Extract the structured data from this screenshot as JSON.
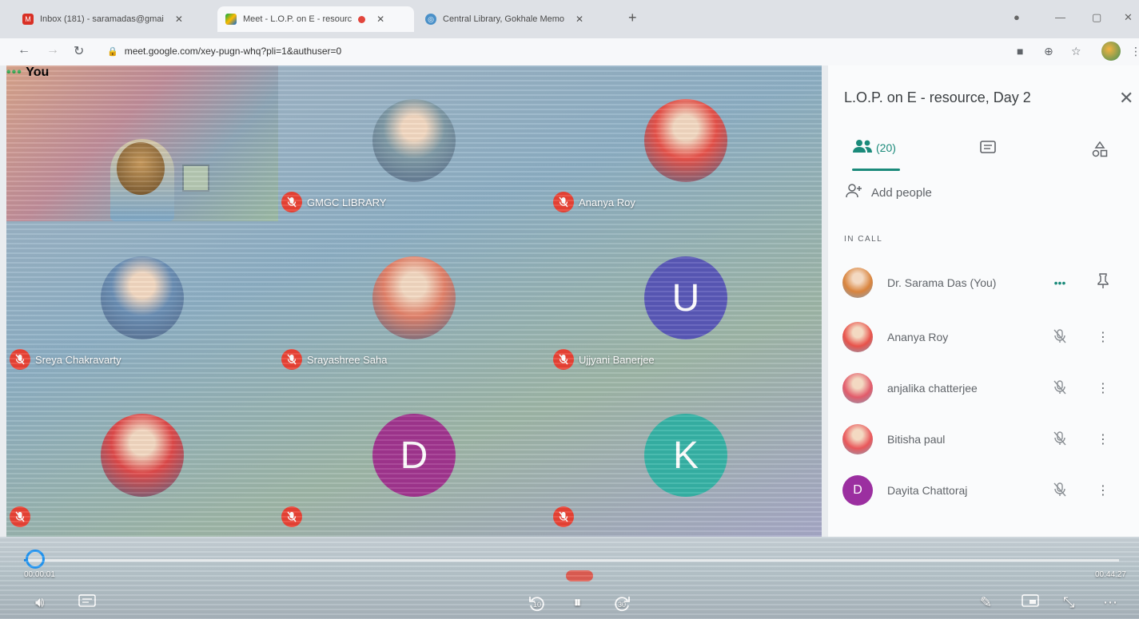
{
  "browser": {
    "tabs": [
      {
        "title": "Inbox (181) - saramadas@gmai",
        "favicon": "gmail-icon",
        "active": false
      },
      {
        "title": "Meet - L.O.P. on E - resourc",
        "favicon": "meet-icon",
        "active": true,
        "recording": true
      },
      {
        "title": "Central Library, Gokhale Memo",
        "favicon": "globe-icon",
        "active": false
      }
    ],
    "url": "meet.google.com/xey-pugn-whq?pli=1&authuser=0"
  },
  "grid": {
    "tiles": [
      {
        "name": "You",
        "type": "self"
      },
      {
        "name": "GMGC LIBRARY",
        "type": "photo",
        "bg": "#7f9aa6"
      },
      {
        "name": "Ananya Roy",
        "type": "photo",
        "bg": "#e8524a"
      },
      {
        "name": "Sreya Chakravarty",
        "type": "photo",
        "bg": "#6b8fb5"
      },
      {
        "name": "Srayashree Saha",
        "type": "photo",
        "bg": "#e4826a"
      },
      {
        "name": "Ujjyani Banerjee",
        "type": "letter",
        "letter": "U",
        "bg": "#5a58b8"
      },
      {
        "name": "",
        "type": "photo",
        "bg": "#e04a4a"
      },
      {
        "name": "",
        "type": "letter",
        "letter": "D",
        "bg": "#a1358f"
      },
      {
        "name": "",
        "type": "letter",
        "letter": "K",
        "bg": "#36b3a6"
      }
    ]
  },
  "panel": {
    "title": "L.O.P. on E - resource, Day 2",
    "people_count": "(20)",
    "add_people": "Add people",
    "section": "IN CALL",
    "participants": [
      {
        "name": "Dr. Sarama Das (You)",
        "avatar": "photo",
        "bg": "#d9843d",
        "action1": "•••",
        "action2": "pin-icon"
      },
      {
        "name": "Ananya Roy",
        "avatar": "photo",
        "bg": "#e8524a",
        "action1": "mic-off-icon",
        "action2": "more-icon"
      },
      {
        "name": "anjalika chatterjee",
        "avatar": "photo",
        "bg": "#e25b6a",
        "action1": "mic-off-icon",
        "action2": "more-icon"
      },
      {
        "name": "Bitisha paul",
        "avatar": "photo",
        "bg": "#e9575a",
        "action1": "mic-off-icon",
        "action2": "more-icon"
      },
      {
        "name": "Dayita Chattoraj",
        "avatar": "letter",
        "letter": "D",
        "bg": "#9b2fa0",
        "action1": "mic-off-icon",
        "action2": "more-icon"
      }
    ]
  },
  "player": {
    "current_time": "00:00:01",
    "total_time": "00:44:27",
    "progress": 0.001,
    "skip_back": "10",
    "skip_forward": "30"
  },
  "colors": {
    "accent": "#1a8a7a",
    "mic_off": "#ea4335",
    "player_blue": "#2196f3"
  }
}
